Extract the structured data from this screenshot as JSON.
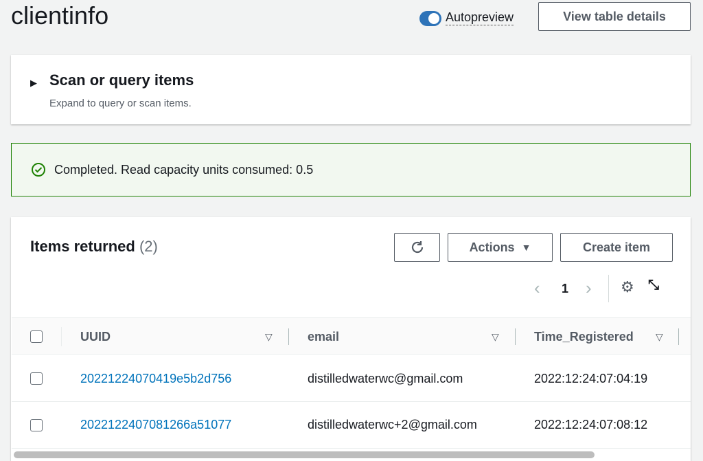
{
  "title": "clientinfo",
  "autopreview": {
    "label": "Autopreview",
    "enabled": true
  },
  "view_details_label": "View table details",
  "scan": {
    "title": "Scan or query items",
    "subtitle": "Expand to query or scan items."
  },
  "alert": {
    "text": "Completed. Read capacity units consumed: 0.5",
    "color": "#1d8102"
  },
  "items": {
    "title": "Items returned",
    "count": "(2)",
    "actions_label": "Actions",
    "create_label": "Create item",
    "page": "1"
  },
  "columns": [
    "UUID",
    "email",
    "Time_Registered"
  ],
  "rows": [
    {
      "uuid": "20221224070419e5b2d756",
      "email": "distilledwaterwc@gmail.com",
      "time": "2022:12:24:07:04:19"
    },
    {
      "uuid": "2022122407081266a51077",
      "email": "distilledwaterwc+2@gmail.com",
      "time": "2022:12:24:07:08:12"
    }
  ]
}
